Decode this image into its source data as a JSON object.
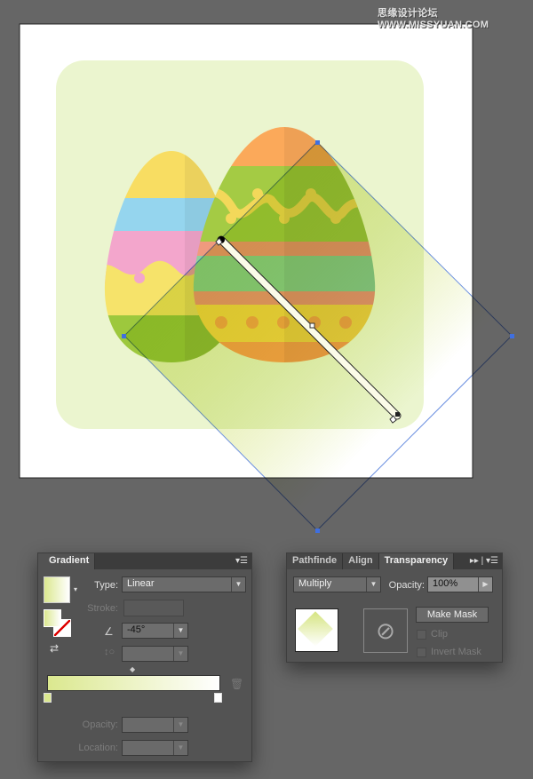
{
  "watermark": "思缘设计论坛 WWW.MISSYUAN.COM",
  "colors": {
    "artboard": "#ffffff",
    "background_shape": "#ebf5cf",
    "gradient_start": "#dbe88f",
    "gradient_end": "#ffffff",
    "anchor": "#3f6fe0"
  },
  "gradient_panel": {
    "title": "Gradient",
    "type_label": "Type:",
    "type_value": "Linear",
    "stroke_label": "Stroke:",
    "angle_value": "-45°",
    "opacity_label": "Opacity:",
    "location_label": "Location:",
    "icons": [
      "menu-icon",
      "angle-icon",
      "aspect-ratio-icon",
      "trash-icon",
      "reverse-gradient-icon"
    ]
  },
  "transparency_panel": {
    "tabs": [
      "Pathfinde",
      "Align",
      "Transparency"
    ],
    "blend_mode": "Multiply",
    "opacity_label": "Opacity:",
    "opacity_value": "100%",
    "make_mask": "Make Mask",
    "clip": "Clip",
    "invert_mask": "Invert Mask"
  }
}
